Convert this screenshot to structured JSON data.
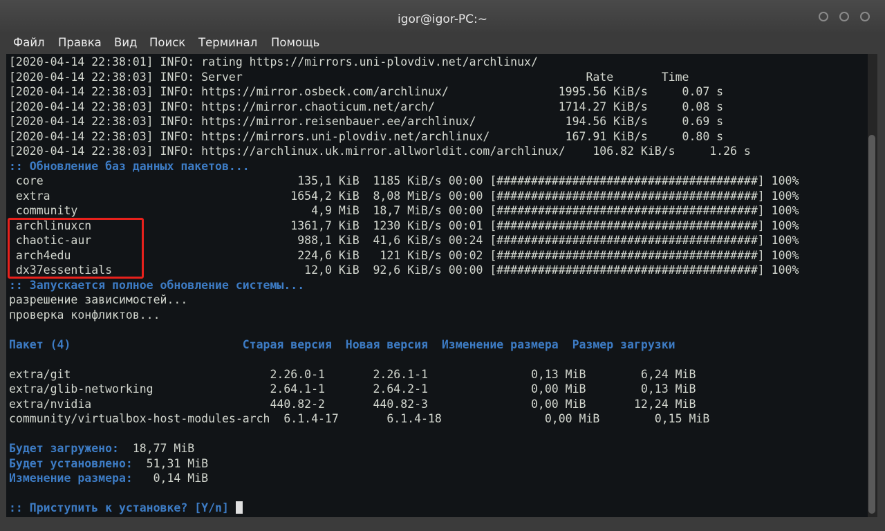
{
  "window": {
    "title": "igor@igor-PC:~"
  },
  "menu": [
    "Файл",
    "Правка",
    "Вид",
    "Поиск",
    "Терминал",
    "Помощь"
  ],
  "terminal": {
    "lines": [
      {
        "text": "[2020-04-14 22:38:01] INFO: rating https://mirrors.uni-plovdiv.net/archlinux/"
      },
      {
        "text": "[2020-04-14 22:38:03] INFO: Server                                                  Rate       Time"
      },
      {
        "text": "[2020-04-14 22:38:03] INFO: https://mirror.osbeck.com/archlinux/                1995.56 KiB/s     0.07 s"
      },
      {
        "text": "[2020-04-14 22:38:03] INFO: https://mirror.chaoticum.net/arch/                  1714.27 KiB/s     0.08 s"
      },
      {
        "text": "[2020-04-14 22:38:03] INFO: https://mirror.reisenbauer.ee/archlinux/             194.56 KiB/s     0.69 s"
      },
      {
        "text": "[2020-04-14 22:38:03] INFO: https://mirrors.uni-plovdiv.net/archlinux/           167.91 KiB/s     0.80 s"
      },
      {
        "text": "[2020-04-14 22:38:03] INFO: https://archlinux.uk.mirror.allworldit.com/archlinux/    106.82 KiB/s     1.26 s"
      },
      {
        "text": ":: Обновление баз данных пакетов...",
        "style": "blue"
      },
      {
        "text": " core                                     135,1 KiB  1185 KiB/s 00:00 [######################################] 100%"
      },
      {
        "text": " extra                                   1654,2 KiB  8,08 MiB/s 00:00 [######################################] 100%"
      },
      {
        "text": " community                                  4,9 MiB  18,7 MiB/s 00:00 [######################################] 100%"
      },
      {
        "text": " archlinuxcn                             1361,7 KiB  1230 KiB/s 00:01 [######################################] 100%"
      },
      {
        "text": " chaotic-aur                              988,1 KiB  41,6 KiB/s 00:24 [######################################] 100%"
      },
      {
        "text": " arch4edu                                 224,6 KiB   121 KiB/s 00:02 [######################################] 100%"
      },
      {
        "text": " dx37essentials                            12,0 KiB  92,6 KiB/s 00:00 [######################################] 100%"
      },
      {
        "text": ":: Запускается полное обновление системы...",
        "style": "blue"
      },
      {
        "text": "разрешение зависимостей..."
      },
      {
        "text": "проверка конфликтов..."
      },
      {
        "text": ""
      },
      {
        "text": "Пакет (4)                         Старая версия  Новая версия  Изменение размера  Размер загрузки",
        "style": "blue"
      },
      {
        "text": ""
      },
      {
        "text": "extra/git                             2.26.0-1       2.26.1-1               0,13 MiB        6,24 MiB"
      },
      {
        "text": "extra/glib-networking                 2.64.1-1       2.64.2-1               0,00 MiB        0,13 MiB"
      },
      {
        "text": "extra/nvidia                          440.82-2       440.82-3               0,00 MiB       12,24 MiB"
      },
      {
        "text": "community/virtualbox-host-modules-arch  6.1.4-17       6.1.4-18               0,00 MiB        0,15 MiB"
      },
      {
        "text": ""
      },
      {
        "text": "Будет загружено:  18,77 MiB",
        "style": "blue-label",
        "label": "Будет загружено:",
        "value": "  18,77 MiB"
      },
      {
        "text": "Будет установлено:  51,31 MiB",
        "style": "blue-label",
        "label": "Будет установлено:",
        "value": "  51,31 MiB"
      },
      {
        "text": "Изменение размера:   0,14 MiB",
        "style": "blue-label",
        "label": "Изменение размера:",
        "value": "   0,14 MiB"
      },
      {
        "text": ""
      },
      {
        "text": ":: Приступить к установке? [Y/n] ",
        "style": "prompt"
      }
    ]
  }
}
